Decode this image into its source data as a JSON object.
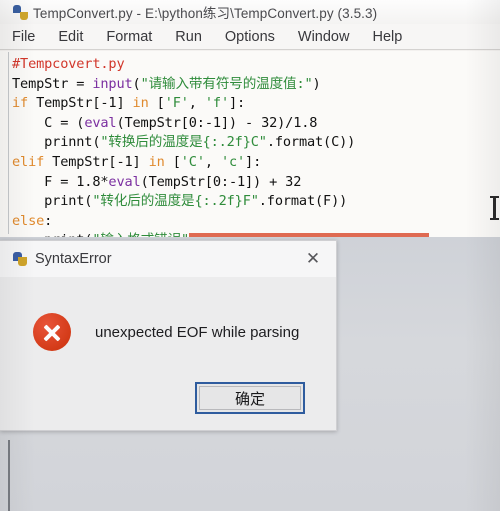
{
  "window": {
    "title": "TempConvert.py - E:\\python练习\\TempConvert.py (3.5.3)",
    "icon": "python-icon",
    "menu": [
      "File",
      "Edit",
      "Format",
      "Run",
      "Options",
      "Window",
      "Help"
    ]
  },
  "code": {
    "lines": [
      [
        {
          "t": "#Tempcovert.py",
          "c": "comment"
        }
      ],
      [
        {
          "t": "TempStr = ",
          "c": "plain"
        },
        {
          "t": "input",
          "c": "builtin"
        },
        {
          "t": "(",
          "c": "plain"
        },
        {
          "t": "\"请输入带有符号的温度值:\"",
          "c": "string"
        },
        {
          "t": ")",
          "c": "plain"
        }
      ],
      [
        {
          "t": "if",
          "c": "keyword"
        },
        {
          "t": " TempStr[-1] ",
          "c": "plain"
        },
        {
          "t": "in",
          "c": "keyword"
        },
        {
          "t": " [",
          "c": "plain"
        },
        {
          "t": "'F'",
          "c": "string"
        },
        {
          "t": ", ",
          "c": "plain"
        },
        {
          "t": "'f'",
          "c": "string"
        },
        {
          "t": "]:",
          "c": "plain"
        }
      ],
      [
        {
          "t": "    C = (",
          "c": "plain"
        },
        {
          "t": "eval",
          "c": "builtin"
        },
        {
          "t": "(TempStr[0:-1]) - 32)/1.8",
          "c": "plain"
        }
      ],
      [
        {
          "t": "    prinnt(",
          "c": "plain"
        },
        {
          "t": "\"转换后的温度是{:.2f}C\"",
          "c": "string"
        },
        {
          "t": ".format(C))",
          "c": "plain"
        }
      ],
      [
        {
          "t": "elif",
          "c": "keyword"
        },
        {
          "t": " TempStr[-1] ",
          "c": "plain"
        },
        {
          "t": "in",
          "c": "keyword"
        },
        {
          "t": " [",
          "c": "plain"
        },
        {
          "t": "'C'",
          "c": "string"
        },
        {
          "t": ", ",
          "c": "plain"
        },
        {
          "t": "'c'",
          "c": "string"
        },
        {
          "t": "]:",
          "c": "plain"
        }
      ],
      [
        {
          "t": "    F = 1.8*",
          "c": "plain"
        },
        {
          "t": "eval",
          "c": "builtin"
        },
        {
          "t": "(TempStr[0:-1]) + 32",
          "c": "plain"
        }
      ],
      [
        {
          "t": "    print(",
          "c": "plain"
        },
        {
          "t": "\"转化后的温度是{:.2f}F\"",
          "c": "string"
        },
        {
          "t": ".format(F))",
          "c": "plain"
        }
      ],
      [
        {
          "t": "else",
          "c": "keyword"
        },
        {
          "t": ":",
          "c": "plain"
        }
      ],
      [
        {
          "t": "    print(",
          "c": "plain"
        },
        {
          "t": "\"输入格式错误\"",
          "c": "string"
        },
        {
          "t": "",
          "c": "errorbar"
        }
      ]
    ],
    "error_highlight_color": "#df6a52",
    "colors": {
      "comment": "#d2372b",
      "keyword": "#e08a2e",
      "builtin": "#7b2fa0",
      "string": "#2f8c3b",
      "plain": "#111111"
    }
  },
  "dialog": {
    "title": "SyntaxError",
    "icon": "python-icon",
    "close_label": "✕",
    "error_icon": "error-circle-x-icon",
    "message": "unexpected EOF while parsing",
    "ok_label": "确定",
    "accent_color": "#2f5c9e",
    "error_color": "#d33a17"
  }
}
